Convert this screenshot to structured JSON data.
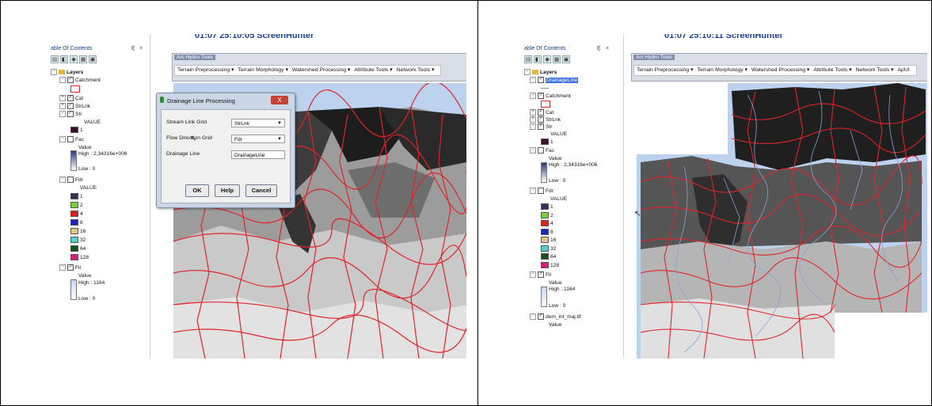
{
  "left": {
    "caption": "01:07 25:10:05 ScreenHunter",
    "toc": {
      "title": "able Of Contents",
      "pin": "Ȩ",
      "close": "×",
      "layers_label": "Layers",
      "items": {
        "catchment": "Catchment",
        "cat": "Cat",
        "strlnk": "StrLnk",
        "str": "Str",
        "str_value": "VALUE",
        "str_1": "1",
        "fac": "Fac",
        "fac_value": "Value",
        "fac_high": "High : 2,34316e+006",
        "fac_low": "Low : 0",
        "fdr": "Fdr",
        "fdr_value": "VALUE",
        "fil": "Fil",
        "fil_value": "Value",
        "fil_high": "High : 1164",
        "fil_low": "Low : 0"
      },
      "fdr_classes": [
        "1",
        "2",
        "4",
        "8",
        "16",
        "32",
        "64",
        "128"
      ]
    },
    "hydro": {
      "title": "Arc Hydro Tools",
      "menus": [
        "Terrain Preprocessing ▾",
        "Terrain Morphology ▾",
        "Watershed Processing ▾",
        "Attribute Tools ▾",
        "Network Tools ▾"
      ]
    },
    "dialog": {
      "title": "Drainage Line Processing",
      "close": "X",
      "stream_link_label": "Stream Link Grid",
      "stream_link_value": "StrLnk",
      "flow_dir_label": "Flow Direction Grid",
      "flow_dir_value": "Fdr",
      "drainage_label": "Drainage Line",
      "drainage_value": "DrainageLine",
      "ok": "OK",
      "help": "Help",
      "cancel": "Cancel"
    }
  },
  "right": {
    "caption": "01:07 25:10:11 ScreenHunter",
    "toc": {
      "title": "able Of Contents",
      "pin": "Ȩ",
      "close": "×",
      "layers_label": "Layers",
      "items": {
        "drainageline": "DrainageLine",
        "catchment": "Catchment",
        "cat": "Cat",
        "strlnk": "StrLnk",
        "str": "Str",
        "str_value": "VALUE",
        "str_1": "1",
        "fac": "Fac",
        "fac_value": "Value",
        "fac_high": "High : 2,34316e+006",
        "fac_low": "Low : 0",
        "fdr": "Fdr",
        "fdr_value": "VALUE",
        "fil": "Fil",
        "fil_value": "Value",
        "fil_high": "High : 1164",
        "fil_low": "Low : 0",
        "dem": "dem_int_maj.tif",
        "dem_value": "Value"
      },
      "fdr_classes": [
        "1",
        "2",
        "4",
        "8",
        "16",
        "32",
        "64",
        "128"
      ]
    },
    "hydro": {
      "title": "Arc Hydro Tools",
      "menus": [
        "Terrain Preprocessing ▾",
        "Terrain Morphology ▾",
        "Watershed Processing ▾",
        "Attribute Tools ▾",
        "Network Tools ▾",
        "ApUt"
      ]
    }
  },
  "colors": {
    "fdr": [
      "#3b2f5a",
      "#7dd13b",
      "#e02020",
      "#1d24c4",
      "#e2c48a",
      "#52d0cf",
      "#1b4d1c",
      "#d41f7a"
    ],
    "catchment_outline": "#e0242a",
    "str_swatch": "#3a0f2a"
  }
}
